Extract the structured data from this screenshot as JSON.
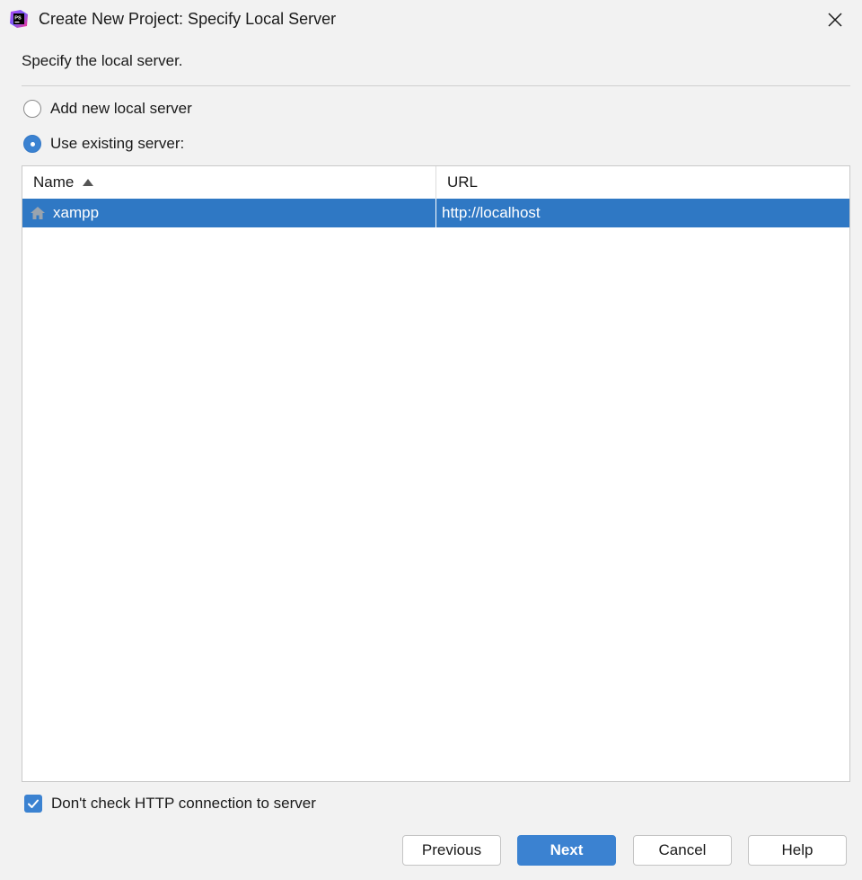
{
  "window": {
    "title": "Create New Project: Specify Local Server",
    "app_icon_text": "PS",
    "close_icon": "close-icon"
  },
  "description": "Specify the local server.",
  "options": {
    "add_new_label": "Add new local server",
    "add_new_selected": false,
    "use_existing_label": "Use existing server:",
    "use_existing_selected": true
  },
  "table": {
    "columns": [
      "Name",
      "URL"
    ],
    "sort_column": "Name",
    "sort_direction": "ascending",
    "rows": [
      {
        "name": "xampp",
        "url": "http://localhost",
        "icon": "home-icon",
        "selected": true
      }
    ]
  },
  "checkbox": {
    "label": "Don't check HTTP connection to server",
    "checked": true
  },
  "buttons": {
    "previous": "Previous",
    "next": "Next",
    "cancel": "Cancel",
    "help": "Help"
  },
  "colors": {
    "accent": "#3b82d1",
    "selection": "#2f78c4",
    "background": "#f2f2f2"
  }
}
